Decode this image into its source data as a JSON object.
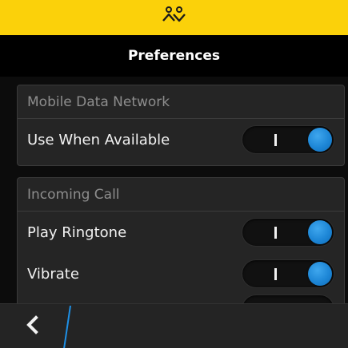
{
  "header": {
    "logo_icon": "blackberry-messenger-logo-icon",
    "title": "Preferences"
  },
  "sections": [
    {
      "header": "Mobile Data Network",
      "items": [
        {
          "label": "Use When Available",
          "enabled": true
        }
      ]
    },
    {
      "header": "Incoming Call",
      "items": [
        {
          "label": "Play Ringtone",
          "enabled": true
        },
        {
          "label": "Vibrate",
          "enabled": true
        }
      ]
    }
  ],
  "footer": {
    "back_icon": "chevron-left-icon"
  },
  "colors": {
    "top_bar": "#fbd10a",
    "toggle_on": "#1d86d6",
    "divider_accent": "#1e90e6"
  }
}
